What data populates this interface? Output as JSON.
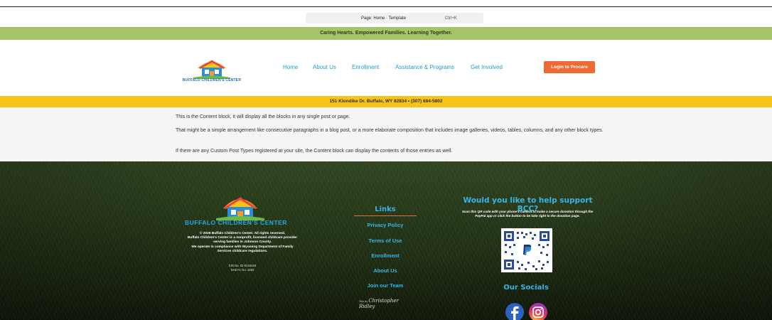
{
  "editor": {
    "command_title": "Page: Home · Template",
    "command_shortcut": "Ctrl+K"
  },
  "tagline": "Caring Hearts. Empowered Families. Learning Together.",
  "header": {
    "logo_text": "BUFFALO CHILDREN'S CENTER",
    "nav": [
      "Home",
      "About Us",
      "Enrollment",
      "Assistance & Programs",
      "Get Involved"
    ],
    "login_label": "Login to Procare"
  },
  "address": "151 Klondike Dr. Buffalo, WY 82834 • (307) 684-5802",
  "content": {
    "paragraphs": [
      "This is the Content block, it will display all the blocks in any single post or page.",
      "That might be a simple arrangement like consecutive paragraphs in a blog post, or a more elaborate composition that includes image galleries, videos, tables, columns, and any other block types.",
      "If there are any Custom Post Types registered at your site, the Content block can display the contents of those entries as well."
    ]
  },
  "footer": {
    "logo_text": "BUFFALO CHILDREN'S CENTER",
    "info_lines": [
      "© 2026 Buffalo Children's Center. All rights reserved.",
      "Buffalo Children's Center is a nonprofit, licensed childcare provider",
      "serving families in Johnson County.",
      "We operate in compliance with Wyoming Department of Family",
      "Services childcare regulations."
    ],
    "ids": [
      "EIN No. 83-0218428",
      "NAEYC No. 1583"
    ],
    "links_heading": "Links",
    "links": [
      "Privacy Policy",
      "Terms of Use",
      "Enrollment",
      "About Us",
      "Join our Team"
    ],
    "site_by_label": "Site by",
    "site_by_signature": "Christopher Ridley",
    "support_heading": "Would you like to help support BCC?",
    "support_text": "Scan this QR code with your phone's camera to make a secure donation through the PayPal app or click the button to be take right to the donation page.",
    "socials_heading": "Our Socials",
    "icons": {
      "facebook": "facebook-icon",
      "instagram": "instagram-icon",
      "qr": "paypal-qr-code"
    }
  },
  "colors": {
    "tagline_bg": "#a5c46a",
    "address_bg": "#f6c418",
    "nav_link": "#1d9fc7",
    "login_button": "#ee6a34",
    "footer_heading": "#35b6e8"
  }
}
